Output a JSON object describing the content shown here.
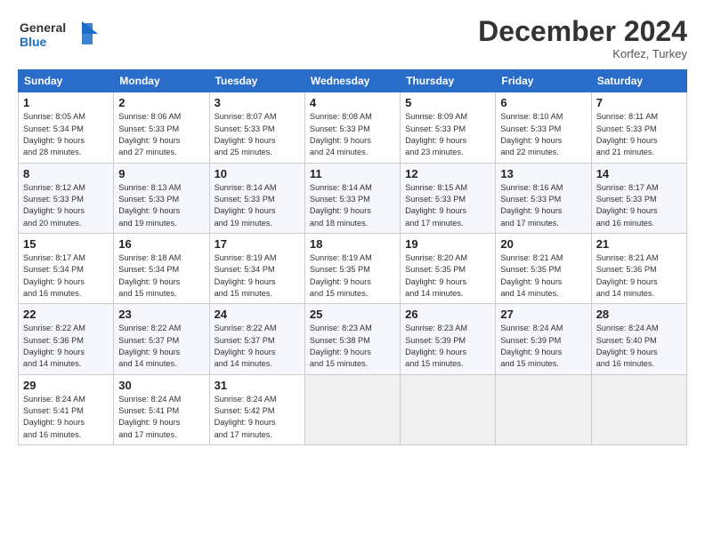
{
  "header": {
    "title": "December 2024",
    "location": "Korfez, Turkey"
  },
  "columns": [
    "Sunday",
    "Monday",
    "Tuesday",
    "Wednesday",
    "Thursday",
    "Friday",
    "Saturday"
  ],
  "weeks": [
    [
      {
        "day": "1",
        "info": "Sunrise: 8:05 AM\nSunset: 5:34 PM\nDaylight: 9 hours\nand 28 minutes."
      },
      {
        "day": "2",
        "info": "Sunrise: 8:06 AM\nSunset: 5:33 PM\nDaylight: 9 hours\nand 27 minutes."
      },
      {
        "day": "3",
        "info": "Sunrise: 8:07 AM\nSunset: 5:33 PM\nDaylight: 9 hours\nand 25 minutes."
      },
      {
        "day": "4",
        "info": "Sunrise: 8:08 AM\nSunset: 5:33 PM\nDaylight: 9 hours\nand 24 minutes."
      },
      {
        "day": "5",
        "info": "Sunrise: 8:09 AM\nSunset: 5:33 PM\nDaylight: 9 hours\nand 23 minutes."
      },
      {
        "day": "6",
        "info": "Sunrise: 8:10 AM\nSunset: 5:33 PM\nDaylight: 9 hours\nand 22 minutes."
      },
      {
        "day": "7",
        "info": "Sunrise: 8:11 AM\nSunset: 5:33 PM\nDaylight: 9 hours\nand 21 minutes."
      }
    ],
    [
      {
        "day": "8",
        "info": "Sunrise: 8:12 AM\nSunset: 5:33 PM\nDaylight: 9 hours\nand 20 minutes."
      },
      {
        "day": "9",
        "info": "Sunrise: 8:13 AM\nSunset: 5:33 PM\nDaylight: 9 hours\nand 19 minutes."
      },
      {
        "day": "10",
        "info": "Sunrise: 8:14 AM\nSunset: 5:33 PM\nDaylight: 9 hours\nand 19 minutes."
      },
      {
        "day": "11",
        "info": "Sunrise: 8:14 AM\nSunset: 5:33 PM\nDaylight: 9 hours\nand 18 minutes."
      },
      {
        "day": "12",
        "info": "Sunrise: 8:15 AM\nSunset: 5:33 PM\nDaylight: 9 hours\nand 17 minutes."
      },
      {
        "day": "13",
        "info": "Sunrise: 8:16 AM\nSunset: 5:33 PM\nDaylight: 9 hours\nand 17 minutes."
      },
      {
        "day": "14",
        "info": "Sunrise: 8:17 AM\nSunset: 5:33 PM\nDaylight: 9 hours\nand 16 minutes."
      }
    ],
    [
      {
        "day": "15",
        "info": "Sunrise: 8:17 AM\nSunset: 5:34 PM\nDaylight: 9 hours\nand 16 minutes."
      },
      {
        "day": "16",
        "info": "Sunrise: 8:18 AM\nSunset: 5:34 PM\nDaylight: 9 hours\nand 15 minutes."
      },
      {
        "day": "17",
        "info": "Sunrise: 8:19 AM\nSunset: 5:34 PM\nDaylight: 9 hours\nand 15 minutes."
      },
      {
        "day": "18",
        "info": "Sunrise: 8:19 AM\nSunset: 5:35 PM\nDaylight: 9 hours\nand 15 minutes."
      },
      {
        "day": "19",
        "info": "Sunrise: 8:20 AM\nSunset: 5:35 PM\nDaylight: 9 hours\nand 14 minutes."
      },
      {
        "day": "20",
        "info": "Sunrise: 8:21 AM\nSunset: 5:35 PM\nDaylight: 9 hours\nand 14 minutes."
      },
      {
        "day": "21",
        "info": "Sunrise: 8:21 AM\nSunset: 5:36 PM\nDaylight: 9 hours\nand 14 minutes."
      }
    ],
    [
      {
        "day": "22",
        "info": "Sunrise: 8:22 AM\nSunset: 5:36 PM\nDaylight: 9 hours\nand 14 minutes."
      },
      {
        "day": "23",
        "info": "Sunrise: 8:22 AM\nSunset: 5:37 PM\nDaylight: 9 hours\nand 14 minutes."
      },
      {
        "day": "24",
        "info": "Sunrise: 8:22 AM\nSunset: 5:37 PM\nDaylight: 9 hours\nand 14 minutes."
      },
      {
        "day": "25",
        "info": "Sunrise: 8:23 AM\nSunset: 5:38 PM\nDaylight: 9 hours\nand 15 minutes."
      },
      {
        "day": "26",
        "info": "Sunrise: 8:23 AM\nSunset: 5:39 PM\nDaylight: 9 hours\nand 15 minutes."
      },
      {
        "day": "27",
        "info": "Sunrise: 8:24 AM\nSunset: 5:39 PM\nDaylight: 9 hours\nand 15 minutes."
      },
      {
        "day": "28",
        "info": "Sunrise: 8:24 AM\nSunset: 5:40 PM\nDaylight: 9 hours\nand 16 minutes."
      }
    ],
    [
      {
        "day": "29",
        "info": "Sunrise: 8:24 AM\nSunset: 5:41 PM\nDaylight: 9 hours\nand 16 minutes."
      },
      {
        "day": "30",
        "info": "Sunrise: 8:24 AM\nSunset: 5:41 PM\nDaylight: 9 hours\nand 17 minutes."
      },
      {
        "day": "31",
        "info": "Sunrise: 8:24 AM\nSunset: 5:42 PM\nDaylight: 9 hours\nand 17 minutes."
      },
      {
        "day": "",
        "info": ""
      },
      {
        "day": "",
        "info": ""
      },
      {
        "day": "",
        "info": ""
      },
      {
        "day": "",
        "info": ""
      }
    ]
  ]
}
